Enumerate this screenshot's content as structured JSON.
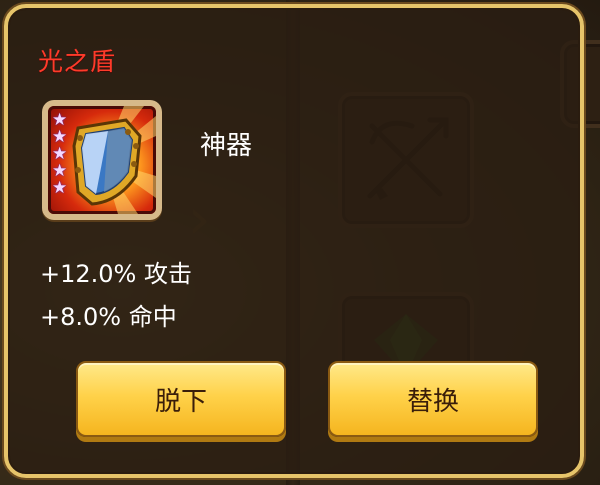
{
  "item": {
    "name": "光之盾",
    "name_color": "#ff3a2a",
    "category": "神器",
    "icon": "shield-icon",
    "rarity_stars": 5,
    "stats": [
      {
        "text": "+12.0% 攻击"
      },
      {
        "text": "+8.0% 命中"
      }
    ]
  },
  "actions": {
    "remove_label": "脱下",
    "replace_label": "替换"
  },
  "background": {
    "slot_icons": [
      "crossed-arrows-icon",
      "gem-icon"
    ]
  }
}
